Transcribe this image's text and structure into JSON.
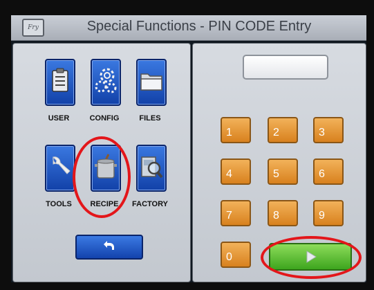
{
  "window": {
    "title": "Special Functions - PIN CODE Entry",
    "logo_text": "Frymaster"
  },
  "left_panel": {
    "icons": [
      {
        "label": "USER",
        "icon": "clipboard-icon"
      },
      {
        "label": "CONFIG",
        "icon": "gears-icon"
      },
      {
        "label": "FILES",
        "icon": "folder-icon"
      },
      {
        "label": "TOOLS",
        "icon": "wrench-icon"
      },
      {
        "label": "RECIPE",
        "icon": "stockpot-icon"
      },
      {
        "label": "FACTORY",
        "icon": "factory-inspect-icon"
      }
    ],
    "back_button_icon": "back-arrow-icon"
  },
  "right_panel": {
    "pin_value": "",
    "keys": [
      "1",
      "2",
      "3",
      "4",
      "5",
      "6",
      "7",
      "8",
      "9",
      "0"
    ],
    "enter_icon": "right-arrow-icon"
  },
  "colors": {
    "tile_blue": "#1f5bd0",
    "key_orange": "#e8962e",
    "enter_green": "#5bc23a",
    "highlight_red": "#e3161a"
  }
}
